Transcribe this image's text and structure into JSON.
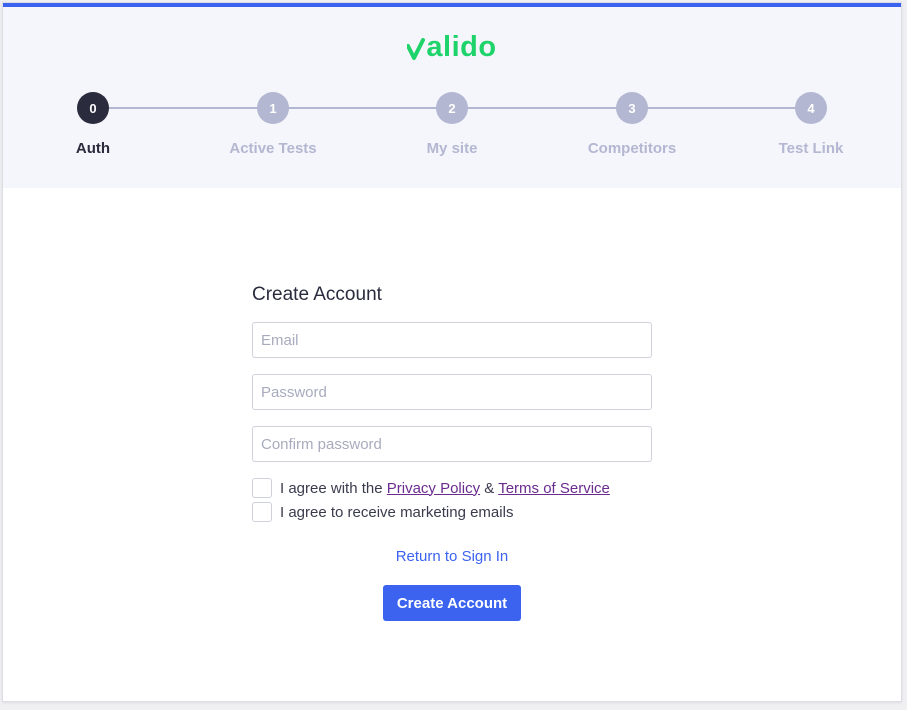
{
  "app": {
    "logo_text": "alido",
    "logo_full": "valido",
    "brand_color": "#1fd36b",
    "accent_color": "#3b63f0"
  },
  "stepper": {
    "steps": [
      {
        "number": "0",
        "label": "Auth",
        "active": true
      },
      {
        "number": "1",
        "label": "Active Tests",
        "active": false
      },
      {
        "number": "2",
        "label": "My site",
        "active": false
      },
      {
        "number": "3",
        "label": "Competitors",
        "active": false
      },
      {
        "number": "4",
        "label": "Test Link",
        "active": false
      }
    ]
  },
  "form": {
    "title": "Create Account",
    "email": {
      "placeholder": "Email",
      "value": ""
    },
    "password": {
      "placeholder": "Password",
      "value": ""
    },
    "confirm_password": {
      "placeholder": "Confirm password",
      "value": ""
    },
    "agree_terms": {
      "prefix": "I agree with the",
      "privacy_link": "Privacy Policy",
      "joiner": "&",
      "terms_link": "Terms of Service",
      "checked": false
    },
    "agree_marketing": {
      "label": "I agree to receive marketing emails",
      "checked": false
    },
    "return_link": "Return to Sign In",
    "submit_label": "Create Account"
  }
}
